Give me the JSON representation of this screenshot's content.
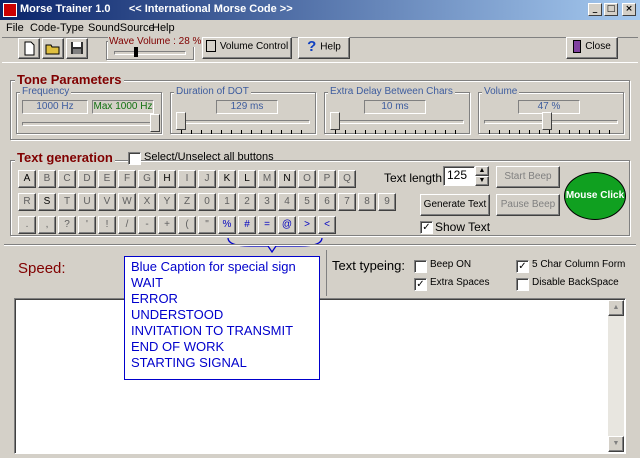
{
  "window": {
    "title": "Morse Trainer 1.0      << International Morse Code >>"
  },
  "menu": [
    "File",
    "Code-Type",
    "SoundSource",
    "Help"
  ],
  "toolbar": {
    "wave_volume_label": "Wave Volume : 28 %",
    "volume_control_label": "Volume Control",
    "help_label": "Help",
    "close_label": "Close"
  },
  "tone": {
    "title": "Tone Parameters",
    "frequency": {
      "label": "Frequency",
      "value": "1000 Hz",
      "max": "Max 1000 Hz"
    },
    "dot": {
      "label": "Duration of DOT",
      "value": "129 ms"
    },
    "delay": {
      "label": "Extra Delay Between Chars",
      "value": "10 ms"
    },
    "volume": {
      "label": "Volume",
      "value": "47 %",
      "level": 0.47
    }
  },
  "textgen": {
    "title": "Text generation",
    "select_all_label": "Select/Unselect all buttons",
    "select_all_checked": false,
    "row1": [
      "A",
      "B",
      "C",
      "D",
      "E",
      "F",
      "G",
      "H",
      "I",
      "J",
      "K",
      "L",
      "M",
      "N",
      "O",
      "P",
      "Q"
    ],
    "row2": [
      "R",
      "S",
      "T",
      "U",
      "V",
      "W",
      "X",
      "Y",
      "Z",
      "0",
      "1",
      "2",
      "3",
      "4",
      "5",
      "6",
      "7",
      "8",
      "9"
    ],
    "row3": [
      ".",
      ",",
      "?",
      "'",
      "!",
      "/",
      "-",
      "+",
      "(",
      "\"",
      "%",
      "#",
      "=",
      "@",
      ">",
      "<"
    ],
    "text_length_label": "Text length",
    "text_length_value": "125",
    "generate_label": "Generate Text",
    "start_beep_label": "Start Beep",
    "pause_beep_label": "Pause Beep",
    "show_text_label": "Show Text",
    "show_text_checked": true,
    "mouse_click_label": "Mouse Click"
  },
  "speed_label": "Speed:",
  "typing": {
    "label": "Text typeing:",
    "beep_on": {
      "label": "Beep ON",
      "checked": false
    },
    "extra_spaces": {
      "label": "Extra Spaces",
      "checked": true
    },
    "five_char": {
      "label": "5 Char Column Form",
      "checked": true
    },
    "disable_backspace": {
      "label": "Disable BackSpace",
      "checked": false
    }
  },
  "caption": {
    "title": "Blue Caption for special sign",
    "lines": [
      "WAIT",
      "ERROR",
      "UNDERSTOOD",
      "INVITATION TO TRANSMIT",
      "END OF WORK",
      "STARTING SIGNAL"
    ]
  },
  "colors": {
    "caption_blue": "#0000cc",
    "mouse_click_green": "#10a020",
    "speed_red": "#800000",
    "value_blue": "#3d5c9e"
  },
  "icons": [
    "app-icon",
    "new-file-icon",
    "open-folder-icon",
    "save-disk-icon",
    "volume-control-icon",
    "help-question-icon",
    "close-door-icon"
  ]
}
